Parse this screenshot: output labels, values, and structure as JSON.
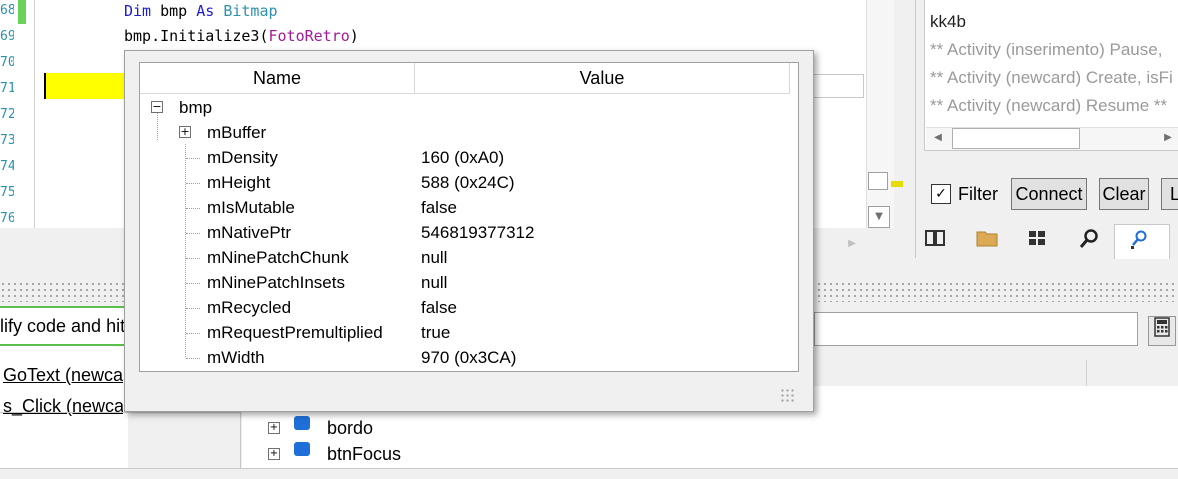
{
  "editor": {
    "line_numbers": [
      "68",
      "69",
      "70",
      "71",
      "72",
      "73",
      "74",
      "75",
      "76"
    ],
    "code_line1": {
      "kw1": "Dim",
      "var": " bmp ",
      "kw2": "As",
      "type": " Bitmap"
    },
    "code_line2": {
      "pre": "bmp.Initialize3(",
      "arg": "FotoRetro",
      "post": ")"
    }
  },
  "logs": {
    "lines": [
      "kk4b",
      "** Activity (inserimento) Pause,",
      "** Activity (newcard) Create, isFi",
      "** Activity (newcard) Resume **"
    ],
    "filter_label": "Filter",
    "filter_checked": "✓",
    "connect_label": "Connect",
    "clear_label": "Clear",
    "partial_button_label": "Li"
  },
  "lower": {
    "hint_text": "lify code and hit",
    "subs": [
      "GoText (newcard)",
      "s_Click (newcard)"
    ],
    "tree_items": [
      "bordo",
      "btnFocus"
    ]
  },
  "watch": {
    "columns": {
      "name": "Name",
      "value": "Value"
    },
    "root": "bmp",
    "rows": [
      {
        "name": "mBuffer",
        "value": "",
        "expandable": true
      },
      {
        "name": "mDensity",
        "value": "160 (0xA0)"
      },
      {
        "name": "mHeight",
        "value": "588 (0x24C)"
      },
      {
        "name": "mIsMutable",
        "value": "false"
      },
      {
        "name": "mNativePtr",
        "value": "546819377312"
      },
      {
        "name": "mNinePatchChunk",
        "value": "null"
      },
      {
        "name": "mNinePatchInsets",
        "value": "null"
      },
      {
        "name": "mRecycled",
        "value": "false"
      },
      {
        "name": "mRequestPremultiplied",
        "value": "true"
      },
      {
        "name": "mWidth",
        "value": "970 (0x3CA)"
      }
    ]
  },
  "icons": {
    "book": "book-icon",
    "folder": "folder-icon",
    "grid": "grid-icon",
    "search": "search-icon",
    "find": "find-usages-icon",
    "calculator": "calculator-icon"
  }
}
